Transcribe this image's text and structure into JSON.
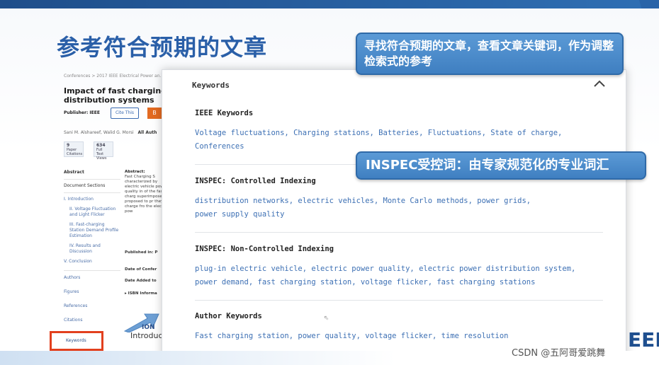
{
  "slide": {
    "title": "参考符合预期的文章",
    "callout_1": "寻找符合预期的文章，查看文章关键词，作为调整检索式的参考",
    "callout_2": "INSPEC受控词：由专家规范化的专业词汇",
    "watermark": "CSDN @五阿哥爱跳舞",
    "corner_logo": "EEE"
  },
  "background_page": {
    "breadcrumb": "Conferences > 2017 IEEE Electrical Power an...",
    "paper_title": "Impact of fast charging st",
    "paper_title_line2": "distribution systems",
    "publisher_label": "Publisher: IEEE",
    "cite_button": "Cite This",
    "orange_button": "B",
    "authors": "Sani M. Alshareef,  Walid G. Morsi",
    "all_authors": "All Auth",
    "metrics": [
      {
        "value": "9",
        "label": "Paper Citations"
      },
      {
        "value": "634",
        "label": "Full Text Views"
      }
    ],
    "nav": {
      "abstract": "Abstract",
      "doc_sections": "Document Sections",
      "sections": [
        "I. Introduction",
        "II. Voltage Fluctuation and Light Flicker",
        "III. Fast-charging Station Demand Profile Estimation",
        "IV. Results and Discussion",
        "V. Conclusion"
      ],
      "authors": "Authors",
      "figures": "Figures",
      "references": "References",
      "citations": "Citations",
      "keywords": "Keywords"
    },
    "abstract_heading": "Abstract:",
    "abstract_text": "Fast Charging S characterized by electric vehicle power quality in of the fast charg superimposed o proposed to pr they charge fro the electric pow",
    "published_in": "Published in: P",
    "date_of_conf": "Date of Confer",
    "date_added": "Date Added to",
    "isbn": "▸ ISBN Informa",
    "intro_heading": "ION",
    "intro_text": "Introduc"
  },
  "keywords_panel": {
    "title": "Keywords",
    "sections": [
      {
        "title": "IEEE Keywords",
        "terms": [
          "Voltage fluctuations, Charging stations, Batteries, Fluctuations, State of charge,",
          "Conferences"
        ]
      },
      {
        "title": "INSPEC: Controlled Indexing",
        "terms": [
          "distribution networks, electric vehicles, Monte Carlo methods, power grids,",
          "power supply quality"
        ]
      },
      {
        "title": "INSPEC: Non-Controlled Indexing",
        "terms": [
          "plug-in electric vehicle, electric power quality, electric power distribution system,",
          "power demand, fast charging station, voltage flicker, fast charging stations"
        ]
      },
      {
        "title": "Author Keywords",
        "terms": [
          "Fast charging station, power quality, voltage flicker, time resolution"
        ]
      }
    ]
  },
  "colors": {
    "accent": "#2a5fa8",
    "callout": "#4a8ccc",
    "link": "#3d70b4",
    "highlight": "#e2401e"
  }
}
